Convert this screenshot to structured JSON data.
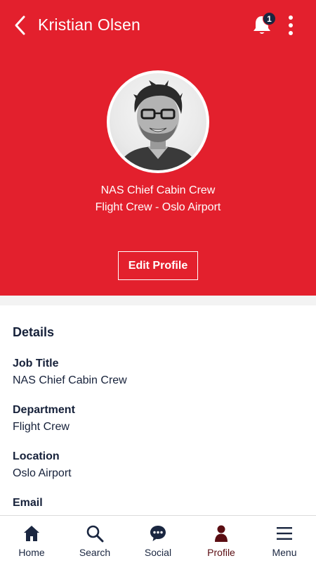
{
  "header": {
    "title": "Kristian Olsen",
    "notification_count": "1",
    "job_line": "NAS Chief Cabin Crew",
    "team_line": "Flight Crew - Oslo Airport",
    "edit_button_label": "Edit Profile",
    "background_color": "#e3202d"
  },
  "details": {
    "heading": "Details",
    "fields": [
      {
        "label": "Job Title",
        "value": "NAS Chief Cabin Crew"
      },
      {
        "label": "Department",
        "value": "Flight Crew"
      },
      {
        "label": "Location",
        "value": "Oslo Airport"
      },
      {
        "label": "Email",
        "value": ""
      }
    ]
  },
  "bottom_nav": {
    "items": [
      {
        "label": "Home",
        "icon": "home-icon"
      },
      {
        "label": "Search",
        "icon": "search-icon"
      },
      {
        "label": "Social",
        "icon": "chat-bubble-icon"
      },
      {
        "label": "Profile",
        "icon": "person-icon"
      },
      {
        "label": "Menu",
        "icon": "hamburger-menu-icon"
      }
    ],
    "active": "Profile",
    "active_color": "#5a0d12",
    "icon_color": "#1a2640"
  }
}
